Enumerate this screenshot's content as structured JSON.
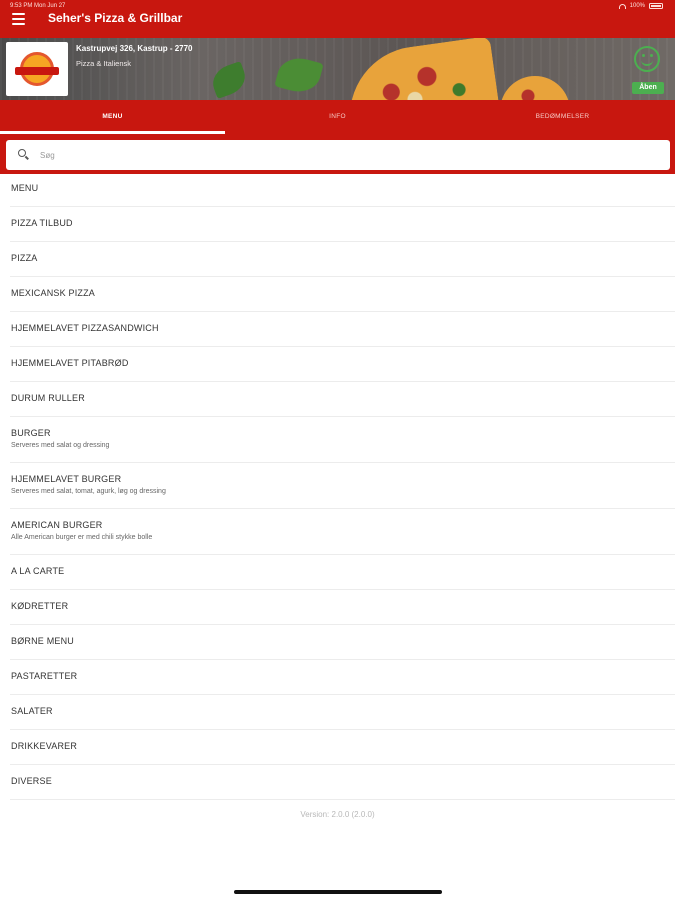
{
  "status_bar": {
    "time": "9:53 PM",
    "date": "Mon Jun 27",
    "battery": "100%"
  },
  "header": {
    "title": "Seher's Pizza & Grillbar",
    "menu_icon": "hamburger-menu-icon"
  },
  "banner": {
    "logo_text": "SEHER'S PIZZA",
    "address": "Kastrupvej 326, Kastrup - 2770",
    "cuisine": "Pizza & Italiensk",
    "open_status": "Åben"
  },
  "tabs": [
    {
      "label": "MENU",
      "active": true
    },
    {
      "label": "INFO",
      "active": false
    },
    {
      "label": "BEDØMMELSER",
      "active": false
    }
  ],
  "search": {
    "placeholder": "Søg",
    "value": ""
  },
  "categories": [
    {
      "name": "MENU",
      "description": ""
    },
    {
      "name": "PIZZA TILBUD",
      "description": ""
    },
    {
      "name": "PIZZA",
      "description": ""
    },
    {
      "name": "MEXICANSK PIZZA",
      "description": ""
    },
    {
      "name": "HJEMMELAVET PIZZASANDWICH",
      "description": ""
    },
    {
      "name": "HJEMMELAVET PITABRØD",
      "description": ""
    },
    {
      "name": "DURUM RULLER",
      "description": ""
    },
    {
      "name": "BURGER",
      "description": "Serveres med salat og dressing"
    },
    {
      "name": "HJEMMELAVET BURGER",
      "description": "Serveres med salat, tomat, agurk, løg og dressing"
    },
    {
      "name": "AMERICAN BURGER",
      "description": "Alle American burger er med chili stykke bolle"
    },
    {
      "name": "A LA CARTE",
      "description": ""
    },
    {
      "name": "KØDRETTER",
      "description": ""
    },
    {
      "name": "BØRNE MENU",
      "description": ""
    },
    {
      "name": "PASTARETTER",
      "description": ""
    },
    {
      "name": "SALATER",
      "description": ""
    },
    {
      "name": "DRIKKEVARER",
      "description": ""
    },
    {
      "name": "DIVERSE",
      "description": ""
    }
  ],
  "footer": {
    "version": "Version: 2.0.0 (2.0.0)"
  },
  "colors": {
    "brand_red": "#c8170f",
    "open_green": "#4caf50"
  }
}
